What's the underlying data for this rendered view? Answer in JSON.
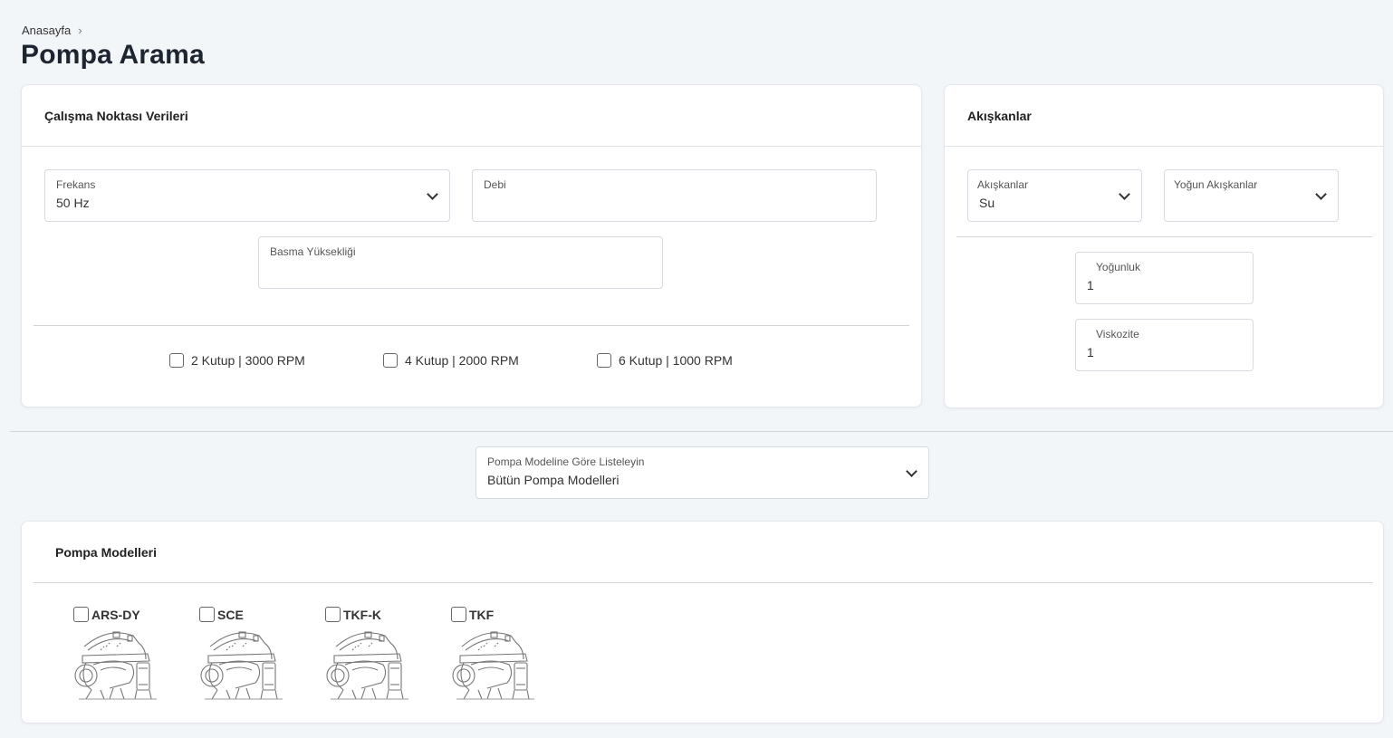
{
  "breadcrumb": {
    "home": "Anasayfa",
    "separator": "›"
  },
  "page": {
    "title": "Pompa Arama"
  },
  "operating_point": {
    "title": "Çalışma Noktası Verileri",
    "frequency": {
      "label": "Frekans",
      "value": "50 Hz"
    },
    "flow": {
      "label": "Debi",
      "value": ""
    },
    "head": {
      "label": "Basma Yüksekliği",
      "value": ""
    },
    "speeds": [
      {
        "label": "2 Kutup | 3000 RPM",
        "checked": false
      },
      {
        "label": "4 Kutup | 2000 RPM",
        "checked": false
      },
      {
        "label": "6 Kutup | 1000 RPM",
        "checked": false
      }
    ]
  },
  "fluids": {
    "title": "Akışkanlar",
    "fluid_select": {
      "label": "Akışkanlar",
      "value": "Su"
    },
    "dense_fluid_select": {
      "label": "Yoğun Akışkanlar",
      "value": ""
    },
    "density": {
      "label": "Yoğunluk",
      "value": "1"
    },
    "viscosity": {
      "label": "Viskozite",
      "value": "1"
    }
  },
  "model_filter": {
    "label": "Pompa Modeline Göre Listeleyin",
    "value": "Bütün Pompa Modelleri"
  },
  "pump_models": {
    "title": "Pompa Modelleri",
    "items": [
      {
        "name": "ARS-DY",
        "checked": false,
        "icon": "pump-illustration-icon"
      },
      {
        "name": "SCE",
        "checked": false,
        "icon": "pump-illustration-icon"
      },
      {
        "name": "TKF-K",
        "checked": false,
        "icon": "pump-illustration-icon"
      },
      {
        "name": "TKF",
        "checked": false,
        "icon": "pump-illustration-icon"
      }
    ]
  }
}
